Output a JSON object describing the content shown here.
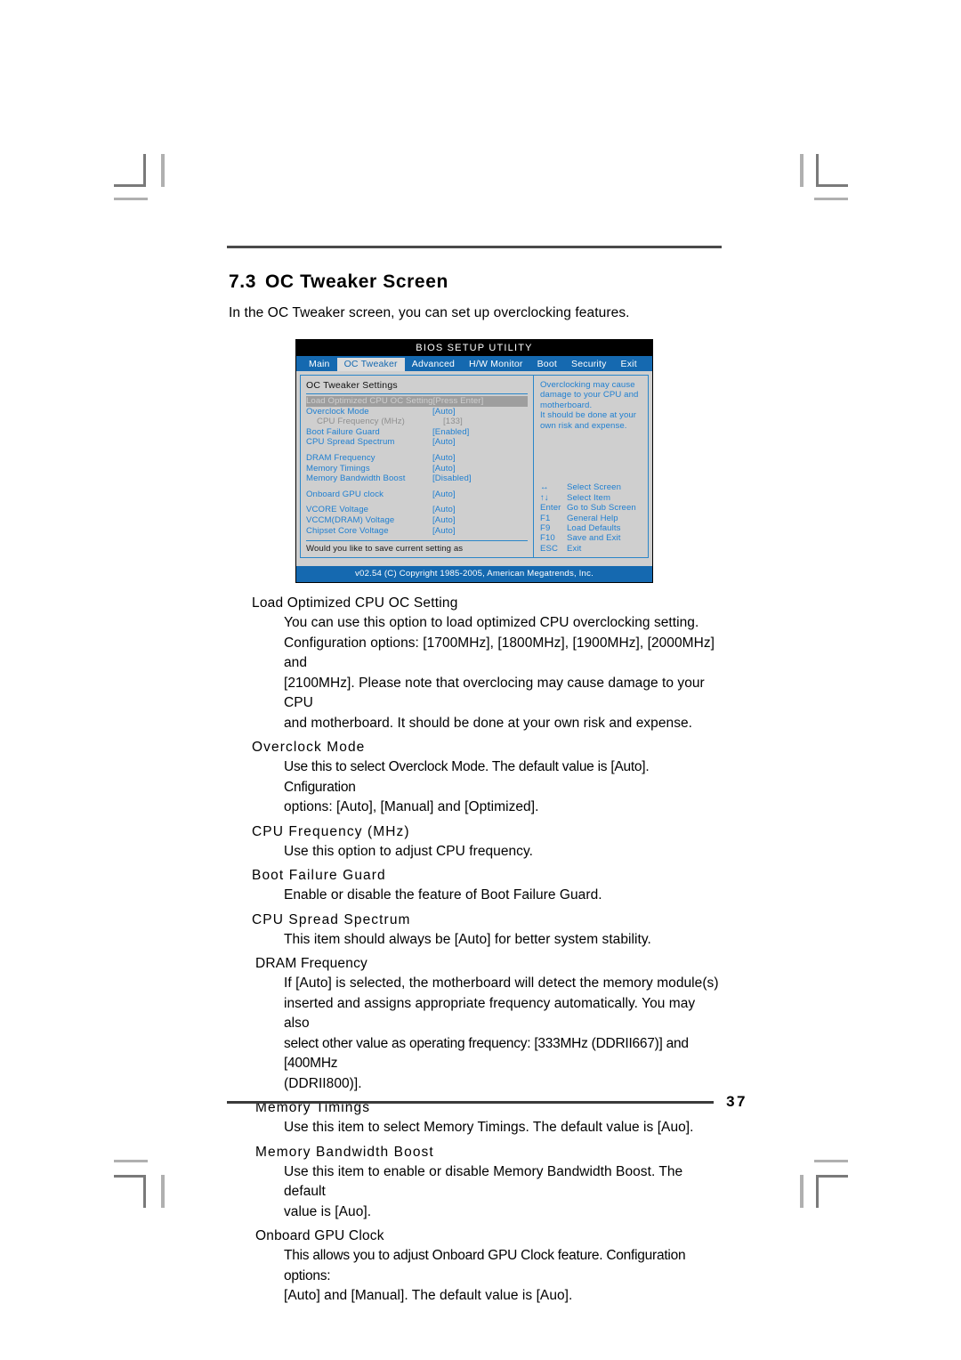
{
  "document": {
    "section_number": "7.3",
    "section_title": "OC Tweaker Screen",
    "intro": "In the OC Tweaker screen, you can set up overclocking features.",
    "page_number": "37"
  },
  "bios": {
    "title": "BIOS SETUP UTILITY",
    "tabs": [
      {
        "label": "Main",
        "active": false
      },
      {
        "label": "OC Tweaker",
        "active": true
      },
      {
        "label": "Advanced",
        "active": false
      },
      {
        "label": "H/W Monitor",
        "active": false
      },
      {
        "label": "Boot",
        "active": false
      },
      {
        "label": "Security",
        "active": false
      },
      {
        "label": "Exit",
        "active": false
      }
    ],
    "panel_heading": "OC Tweaker Settings",
    "settings": [
      {
        "label": "Load Optimized CPU OC Setting",
        "value": "[Press Enter]"
      },
      {
        "label": "Overclock Mode",
        "value": "[Auto]"
      },
      {
        "label": "CPU Frequency  (MHz)",
        "value": "[133]"
      },
      {
        "label": "Boot Failure Guard",
        "value": "[Enabled]"
      },
      {
        "label": "CPU Spread Spectrum",
        "value": "[Auto]"
      },
      {
        "label": "DRAM Frequency",
        "value": "[Auto]"
      },
      {
        "label": "Memory Timings",
        "value": "[Auto]"
      },
      {
        "label": "Memory Bandwidth Boost",
        "value": "[Disabled]"
      },
      {
        "label": "Onboard GPU clock",
        "value": "[Auto]"
      },
      {
        "label": "VCORE Voltage",
        "value": "[Auto]"
      },
      {
        "label": "VCCM(DRAM) Voltage",
        "value": "[Auto]"
      },
      {
        "label": "Chipset Core Voltage",
        "value": "[Auto]"
      }
    ],
    "footnote": "Would you like to save current setting as",
    "help_text": "Overclocking may cause damage to your CPU and motherboard.\nIt should be done at your own risk and expense.",
    "keys": [
      {
        "key": "↔",
        "desc": "Select Screen"
      },
      {
        "key": "↑↓",
        "desc": "Select Item"
      },
      {
        "key": "Enter",
        "desc": "Go to Sub Screen"
      },
      {
        "key": "F1",
        "desc": "General Help"
      },
      {
        "key": "F9",
        "desc": "Load Defaults"
      },
      {
        "key": "F10",
        "desc": "Save and Exit"
      },
      {
        "key": "ESC",
        "desc": "Exit"
      }
    ],
    "copyright": "v02.54 (C) Copyright 1985-2005, American Megatrends, Inc.",
    "colors": {
      "tab_bar": "#1569b0",
      "panel_bg": "#cfcfcf",
      "text_blue": "#1f7fd0",
      "border_blue": "#2a86c9",
      "highlight_grey": "#9e9e9e"
    }
  },
  "descriptions": [
    {
      "term": "Load Optimized CPU OC Setting",
      "lines": [
        "You can use this option to load optimized CPU overclocking setting.",
        "Configuration options: [1700MHz], [1800MHz], [1900MHz], [2000MHz] and",
        "[2100MHz]. Please note that overclocing may cause damage to your CPU",
        "and motherboard. It should be done at your own risk and expense."
      ]
    },
    {
      "term": "Overclock Mode",
      "lines": [
        "Use this to select Overclock Mode. The default value is [Auto]. Cnfiguration",
        "options: [Auto], [Manual] and [Optimized]."
      ]
    },
    {
      "term": "CPU Frequency (MHz)",
      "lines": [
        "Use this option to adjust CPU frequency."
      ]
    },
    {
      "term": "Boot Failure Guard",
      "lines": [
        "Enable or disable the feature of Boot Failure Guard."
      ]
    },
    {
      "term": "CPU Spread Spectrum",
      "lines": [
        "This item should always be [Auto] for better system stability."
      ]
    },
    {
      "term": "DRAM Frequency",
      "lines": [
        "If [Auto] is selected, the motherboard will detect the memory module(s)",
        "inserted and assigns appropriate frequency automatically. You may also",
        "select other value as operating frequency: [333MHz (DDRII667)] and [400MHz",
        "(DDRII800)]."
      ]
    },
    {
      "term": "Memory Timings",
      "lines": [
        "Use this item to select Memory Timings. The default value is [Auo]."
      ]
    },
    {
      "term": "Memory Bandwidth Boost",
      "lines": [
        "Use this item to enable or disable Memory Bandwidth Boost. The default",
        "value is [Auo]."
      ]
    },
    {
      "term": "Onboard GPU Clock",
      "lines": [
        "This allows you to adjust Onboard GPU Clock feature. Configuration options:",
        "[Auto] and [Manual]. The default value is [Auo]."
      ]
    }
  ]
}
